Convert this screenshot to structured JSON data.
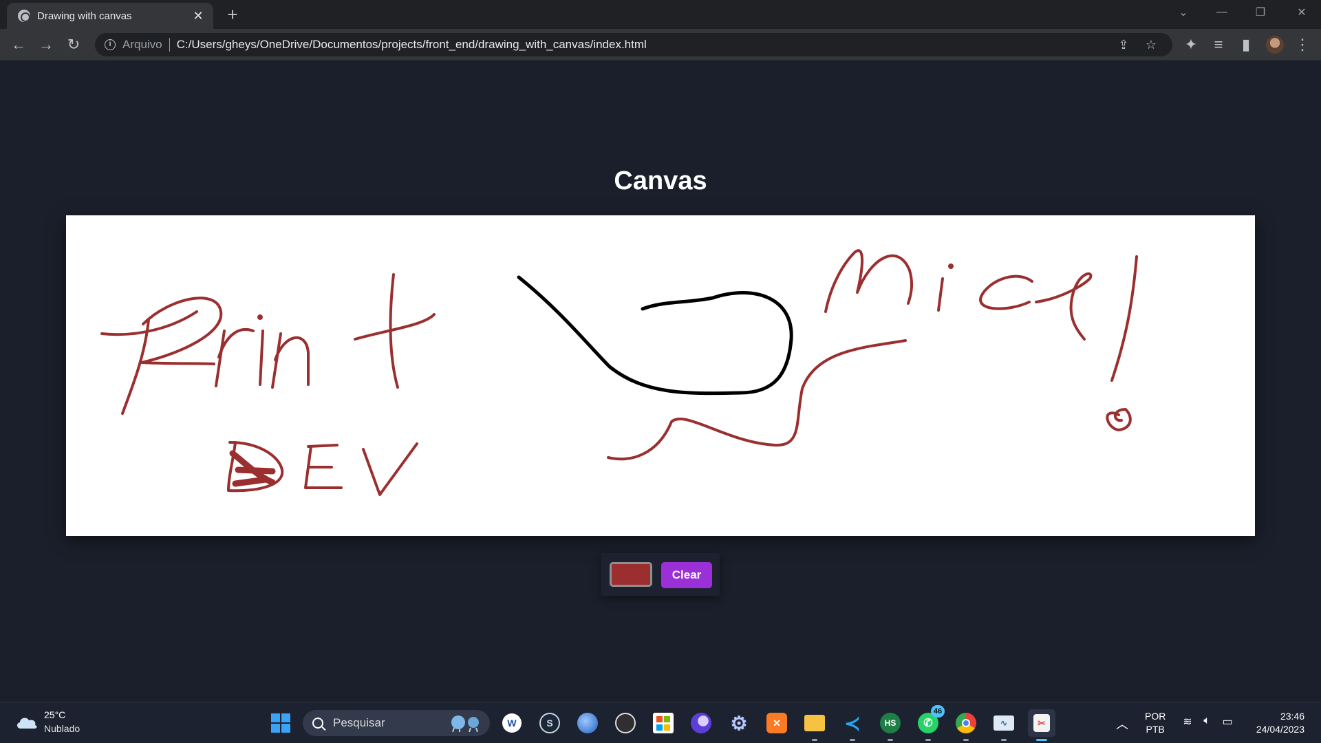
{
  "browser": {
    "tab_title": "Drawing with canvas",
    "address": {
      "scheme_label": "Arquivo",
      "url": "C:/Users/gheys/OneDrive/Documentos/projects/front_end/drawing_with_canvas/index.html"
    }
  },
  "page": {
    "title": "Canvas",
    "canvas": {
      "background": "#ffffff",
      "stroke_colors": [
        "#9b2f2f",
        "#000000"
      ]
    },
    "controls": {
      "selected_color": "#9b2f2f",
      "clear_label": "Clear"
    }
  },
  "taskbar": {
    "weather": {
      "temp": "25°C",
      "desc": "Nublado"
    },
    "search_placeholder": "Pesquisar",
    "apps": [
      {
        "icon": "windows-start-icon"
      },
      {
        "icon": "app-w-icon"
      },
      {
        "icon": "steam-icon"
      },
      {
        "icon": "browser-globe-icon"
      },
      {
        "icon": "obs-icon"
      },
      {
        "icon": "microsoft-store-icon"
      },
      {
        "icon": "purple-moon-icon"
      },
      {
        "icon": "settings-gear-icon"
      },
      {
        "icon": "xampp-icon"
      },
      {
        "icon": "file-explorer-icon"
      },
      {
        "icon": "vscode-icon"
      },
      {
        "icon": "hs-app-icon"
      },
      {
        "icon": "whatsapp-icon",
        "badge": "46"
      },
      {
        "icon": "chrome-icon"
      },
      {
        "icon": "monitor-app-icon"
      },
      {
        "icon": "snipping-tool-icon"
      }
    ],
    "tray": {
      "lang_top": "POR",
      "lang_bottom": "PTB",
      "time": "23:46",
      "date": "24/04/2023"
    }
  }
}
